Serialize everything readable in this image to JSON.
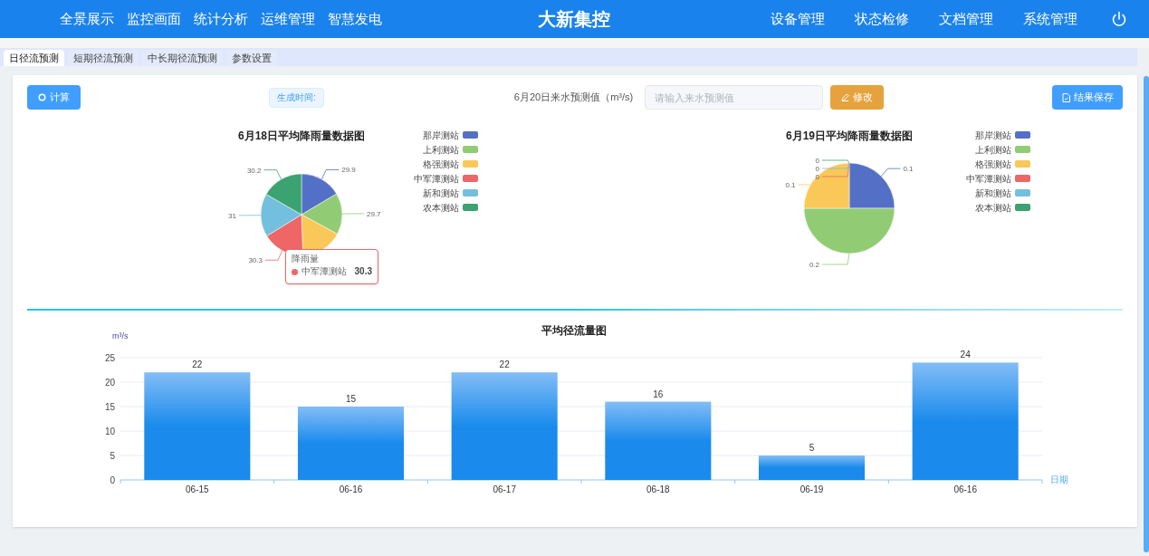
{
  "header": {
    "nav_left": [
      "全景展示",
      "监控画面",
      "统计分析",
      "运维管理",
      "智慧发电"
    ],
    "title": "大新集控",
    "nav_right": [
      "设备管理",
      "状态检修",
      "文档管理",
      "系统管理"
    ]
  },
  "tabs": [
    {
      "label": "日径流预测",
      "selected": true
    },
    {
      "label": "短期径流预测",
      "selected": false
    },
    {
      "label": "中长期径流预测",
      "selected": false
    },
    {
      "label": "参数设置",
      "selected": false
    }
  ],
  "toolbar": {
    "calc_button": "计算",
    "time_label": "生成时间:",
    "forecast_label": "6月20日来水预测值（m³/s)",
    "forecast_input": {
      "placeholder": "请输入来水预测值"
    },
    "edit_button": "修改",
    "save_button": "结果保存"
  },
  "pies": [
    {
      "chart_data": {
        "type": "pie",
        "title": "6月18日平均降雨量数据图",
        "categories": [
          "那岸测站",
          "上利测站",
          "格强测站",
          "中军潭测站",
          "新和测站",
          "农本测站"
        ],
        "legend": {
          "colors": [
            "#5470c6",
            "#91cc75",
            "#fac858",
            "#ee6666",
            "#73c0de",
            "#3ba272"
          ]
        },
        "series": [
          {
            "name": "降雨量",
            "values": [
              16.51,
              16.4,
              16.57,
              16.73,
              17.12,
              16.67
            ]
          }
        ],
        "value_labels": [
          "29.9",
          "29.7",
          null,
          "30.3",
          "31",
          "30.2"
        ]
      },
      "tooltip": {
        "name": "中军潭测站",
        "value": "30.3",
        "color": "#ee6666"
      }
    },
    {
      "chart_data": {
        "type": "pie",
        "title": "6月19日平均降雨量数据图",
        "categories": [
          "那岸测站",
          "上利测站",
          "格强测站",
          "中军潭测站",
          "新和测站",
          "农本测站"
        ],
        "legend": {
          "colors": [
            "#5470c6",
            "#91cc75",
            "#fac858",
            "#ee6666",
            "#73c0de",
            "#3ba272"
          ]
        },
        "series": [
          {
            "values": [
              25,
              50,
              25,
              0,
              0,
              0
            ]
          }
        ],
        "value_labels": [
          "0.1",
          "0.2",
          "0.1",
          "0",
          "0",
          "0"
        ]
      }
    }
  ],
  "bar_chart": {
    "chart_data": {
      "type": "bar",
      "title": "平均径流量图",
      "xlabel": "日期",
      "ylabel": "m³/s",
      "categories": [
        "06-15",
        "06-16",
        "06-17",
        "06-18",
        "06-19",
        "06-16"
      ],
      "values": [
        22,
        15,
        22,
        16,
        5,
        24
      ],
      "ylim": [
        0,
        25
      ],
      "yticks": [
        0,
        5,
        10,
        15,
        20,
        25
      ],
      "grid": true,
      "data_labels": true
    }
  }
}
